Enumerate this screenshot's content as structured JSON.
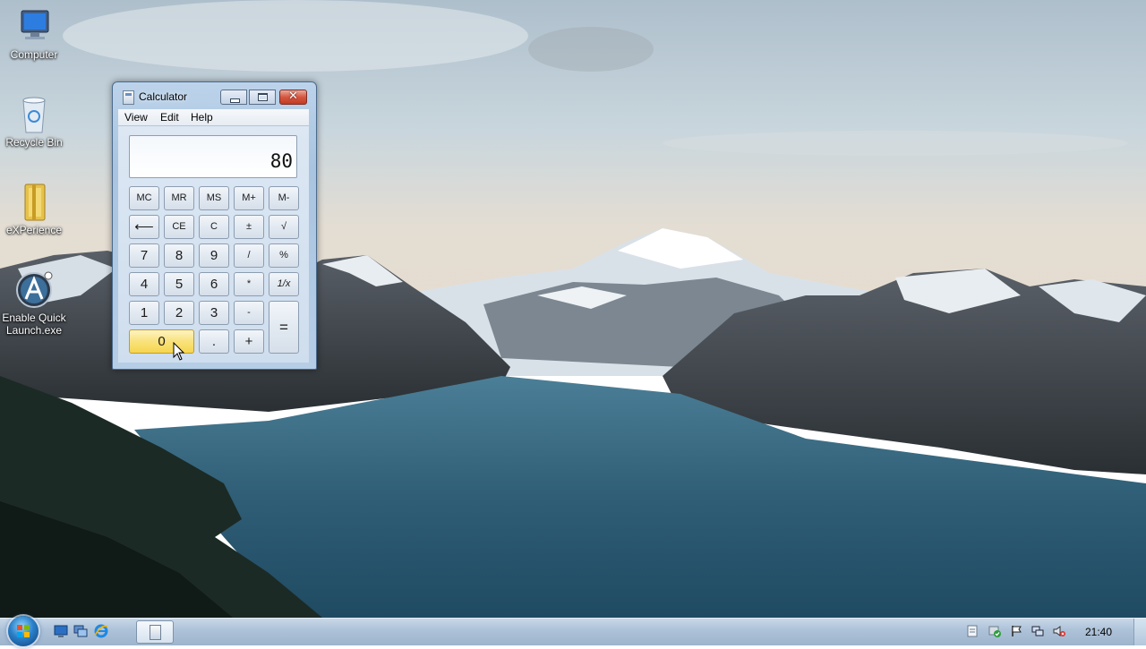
{
  "desktop": {
    "icons": [
      {
        "label": "Computer"
      },
      {
        "label": "Recycle Bin"
      },
      {
        "label": "eXPerience"
      },
      {
        "label": "Enable Quick Launch.exe"
      }
    ]
  },
  "calculator": {
    "title": "Calculator",
    "menu": [
      "View",
      "Edit",
      "Help"
    ],
    "display": "80",
    "keys": {
      "mc": "MC",
      "mr": "MR",
      "ms": "MS",
      "mplus": "M+",
      "mminus": "M-",
      "back": "⟵",
      "ce": "CE",
      "c": "C",
      "plusminus": "±",
      "sqrt": "√",
      "k7": "7",
      "k8": "8",
      "k9": "9",
      "div": "/",
      "pct": "%",
      "k4": "4",
      "k5": "5",
      "k6": "6",
      "mul": "*",
      "recip": "1/x",
      "k1": "1",
      "k2": "2",
      "k3": "3",
      "sub": "-",
      "eq": "=",
      "k0": "0",
      "dot": ".",
      "add": "+"
    }
  },
  "taskbar": {
    "clock": "21:40",
    "icons": [
      "start-orb-icon",
      "show-desktop-icon",
      "window-switch-icon",
      "internet-explorer-icon",
      "calculator-icon"
    ],
    "tray": [
      "notes-icon",
      "security-icon",
      "action-center-flag-icon",
      "network-icon",
      "volume-muted-icon"
    ]
  },
  "colors": {
    "sky": "#c9d6dd",
    "lake": "#2f5e76",
    "taskbar": "#b1c6db",
    "calc_frame": "#b6cde6",
    "zero_key": "#f9e27a"
  }
}
